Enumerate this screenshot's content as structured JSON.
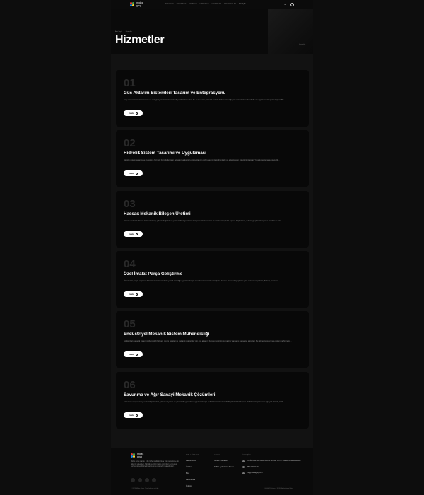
{
  "header": {
    "logo_text": "midas grup",
    "nav": [
      "ANASAYFA",
      "HAKKIMIZDA",
      "ÜRÜNLER",
      "HİZMETLER",
      "SEKTÖRLER",
      "REFERANSLAR",
      "İLETİŞİM"
    ],
    "lang": "TR"
  },
  "hero": {
    "breadcrumb_home": "Ana Sayfa",
    "breadcrumb_current": "Hizmetler",
    "title": "Hizmetler",
    "right_label": "Hizmetler"
  },
  "services": [
    {
      "number": "01",
      "title": "Güç Aktarım Sistemleri Tasarım ve Entegrasyonu",
      "description": "Güç aktarım sistemleri tasarımı ve entegrasyonu hizmeti, mekanik platformlarda ileri, iki- ve kuvvetin güvenilir şekilde iletilmesini sağlayan sistemlerin mühendislik ve uygulama süreçlerini kapsar. Bu...",
      "button": "İncele"
    },
    {
      "number": "02",
      "title": "Hidrolik Sistem Tasarımı ve Uygulaması",
      "description": "Hidrolik sistem tasarımı ve uygulama hizmeti, hidrolik devreler, actuator ve kontrol ekipmanlarının doğru seçimi ile mühendislik ve entegrasyon süreçlerini kapsar. Yüksek performans, güvenlik...",
      "button": "İncele"
    },
    {
      "number": "03",
      "title": "Hassas Mekanik Bileşen Üretimi",
      "description": "Hassas mekanik bileşen üretimi hizmeti, yüksek doğruluk ve yüzey kalitesi gerektiren komponentlerin tasarım ve üretim süreçlerini kapsar. Dişli sistem, rulman grupları, flanşlar ve yataklar ve özel...",
      "button": "İncele"
    },
    {
      "number": "04",
      "title": "Özel İmalat Parça Geliştirme",
      "description": "Özel imalat parça geliştirme hizmeti, standart ürünlerin yeterli olmadığı uygulamalar için tasarlanan ve üretim süreçlerini kapsar. Sistem ihtiyaçlarına göre mekanik ölçeklerin, fiziksel, malzeme...",
      "button": "İncele"
    },
    {
      "number": "05",
      "title": "Endüstriyel Mekanik Sistem Mühendisliği",
      "description": "Endüstriyel mekanik sistem mühendisliği hizmeti, üretim tesisleri ve mekanik platformlar için güç aktarım, hareket kontrolü ve makine yapılarını kapsayan süreçleri. Bu hizmet kapsamında sistem performans...",
      "button": "İncele"
    },
    {
      "number": "06",
      "title": "Savunma ve Ağır Sanayi Mekanik Çözümleri",
      "description": "Savunma ve ağır sanayi mekanik çözümleri, yüksek dayanım ve güvenilirlik gerektiren uygulamalar için geliştirilen özel mühendislik çözümlerini kapsar. Bu hizmet kapsamında ağır yük altında, kritik...",
      "button": "İncele"
    }
  ],
  "footer": {
    "description": "Midas Grup olarak, milli mühendislik gücüyle Türk sanayisine güç aktarım sistemleri, hidrolik ve özel imalat çözümleri sunuyoruz; yerli ve güvenilir üretim anlayışıyla geleceği inşa ediyoruz.",
    "col1_title": "HIZLI LİNKLER",
    "col1_links": [
      "Hakkımızda",
      "Ürünler",
      "Blog",
      "Referanslar",
      "İletişim"
    ],
    "col2_title": "YASAL",
    "col2_links": [
      "Gizlilik Politikası",
      "KVKK Aydınlatma Metni"
    ],
    "col3_title": "İLETİŞİM",
    "address": "OSTİM OSB MAHALLESİ 1234 SOKAK NO:5 YENİMAHALLE/ANKARA",
    "phone": "0850 000 00 00",
    "email": "info@midasgrup.com",
    "copyright": "© 2025 Midas Grup. Tüm hakları saklıdır.",
    "credit": "Gizlilik Politikası · KVKK Aydınlatma Metni"
  },
  "colors": {
    "background": "#0d0d0d",
    "card": "#080808",
    "accent": "#ffffff"
  }
}
